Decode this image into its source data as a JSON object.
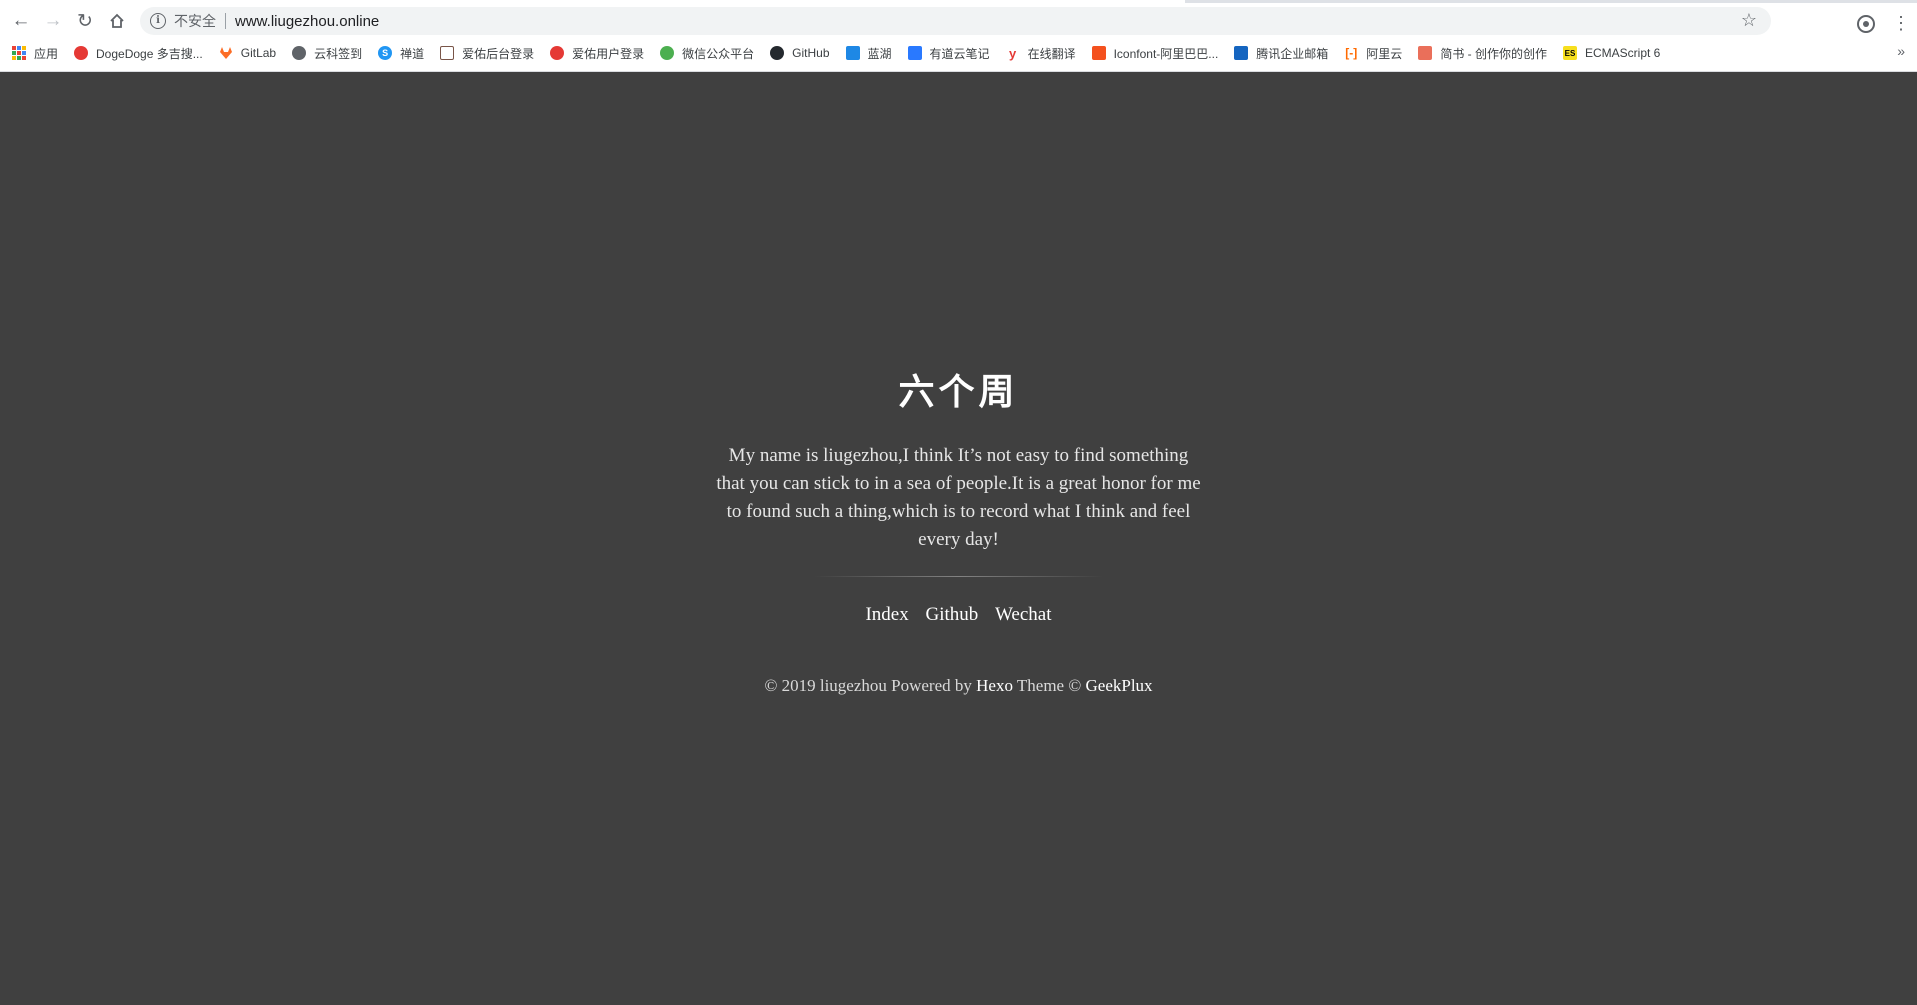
{
  "browser": {
    "security_label": "不安全",
    "url": "www.liugezhou.online"
  },
  "bookmarks": {
    "apps_label": "应用",
    "items": [
      {
        "label": "DogeDoge 多吉搜...",
        "icon": "dogedoge-icon",
        "color": "#e53935"
      },
      {
        "label": "GitLab",
        "icon": "gitlab-icon",
        "color": "#fc6d26"
      },
      {
        "label": "云科签到",
        "icon": "globe-icon",
        "color": "#5f6368"
      },
      {
        "label": "禅道",
        "icon": "zentao-icon",
        "color": "#2196f3"
      },
      {
        "label": "爱佑后台登录",
        "icon": "image-icon",
        "color": "#795548"
      },
      {
        "label": "爱佑用户登录",
        "icon": "flower-icon",
        "color": "#e53935"
      },
      {
        "label": "微信公众平台",
        "icon": "wechat-icon",
        "color": "#4caf50"
      },
      {
        "label": "GitHub",
        "icon": "github-icon",
        "color": "#24292e"
      },
      {
        "label": "蓝湖",
        "icon": "lanhu-icon",
        "color": "#1e88e5"
      },
      {
        "label": "有道云笔记",
        "icon": "youdao-note-icon",
        "color": "#2979ff"
      },
      {
        "label": "在线翻译",
        "icon": "youdao-translate-icon",
        "color": "#e53935"
      },
      {
        "label": "Iconfont-阿里巴巴...",
        "icon": "iconfont-icon",
        "color": "#f4511e"
      },
      {
        "label": "腾讯企业邮箱",
        "icon": "tencent-mail-icon",
        "color": "#1565c0"
      },
      {
        "label": "阿里云",
        "icon": "aliyun-icon",
        "color": "#ff6a00"
      },
      {
        "label": "简书 - 创作你的创作",
        "icon": "jianshu-icon",
        "color": "#ea6f5a"
      },
      {
        "label": "ECMAScript 6",
        "icon": "es6-icon",
        "color": "#f7df1e"
      }
    ]
  },
  "profile": {
    "title": "六个周",
    "bio": "My name is liugezhou,I think It’s not easy to find something that you can stick to in a sea of people.It is a great honor for me to found such a thing,which is to record what I think and feel every day!",
    "links": [
      "Index",
      "Github",
      "Wechat"
    ]
  },
  "footer": {
    "copyright": "© 2019 liugezhou Powered by ",
    "hexo": "Hexo",
    "theme_text": " Theme © ",
    "geekplux": "GeekPlux"
  }
}
